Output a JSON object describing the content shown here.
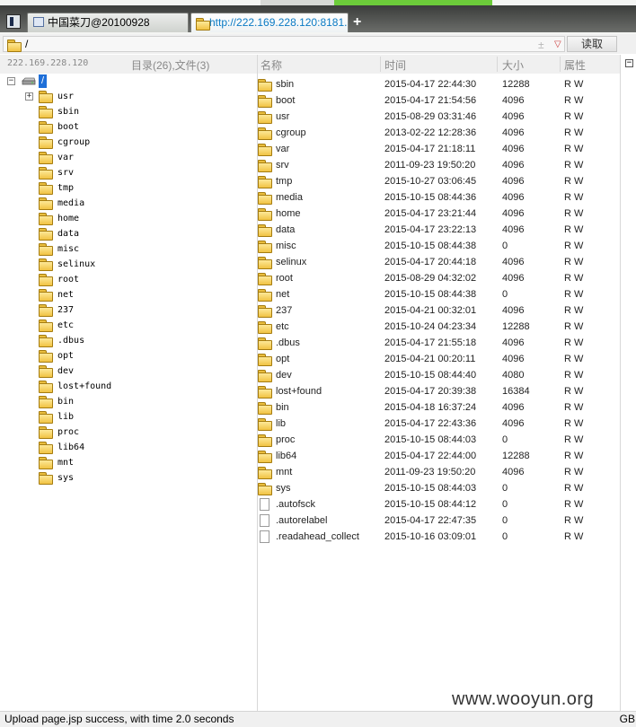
{
  "tabs": [
    {
      "label": "中国菜刀@20100928",
      "active": false
    },
    {
      "label": "http://222.169.228.120:8181...",
      "active": true
    }
  ],
  "new_tab_label": "+",
  "address": {
    "path": "/",
    "star": "±",
    "dropdown": "▽",
    "read_button": "读取"
  },
  "left_header": {
    "server": "222.169.228.120",
    "counts": "目录(26),文件(3)"
  },
  "tree": {
    "root_label": "/",
    "root_expander": "−",
    "usr_expander": "+",
    "items": [
      "usr",
      "sbin",
      "boot",
      "cgroup",
      "var",
      "srv",
      "tmp",
      "media",
      "home",
      "data",
      "misc",
      "selinux",
      "root",
      "net",
      "237",
      "etc",
      ".dbus",
      "opt",
      "dev",
      "lost+found",
      "bin",
      "lib",
      "proc",
      "lib64",
      "mnt",
      "sys"
    ]
  },
  "columns": {
    "name": "名称",
    "time": "时间",
    "size": "大小",
    "attr": "属性"
  },
  "files": [
    {
      "name": "sbin",
      "time": "2015-04-17 22:44:30",
      "size": "12288",
      "attr": "R W",
      "type": "dir"
    },
    {
      "name": "boot",
      "time": "2015-04-17 21:54:56",
      "size": "4096",
      "attr": "R W",
      "type": "dir"
    },
    {
      "name": "usr",
      "time": "2015-08-29 03:31:46",
      "size": "4096",
      "attr": "R W",
      "type": "dir"
    },
    {
      "name": "cgroup",
      "time": "2013-02-22 12:28:36",
      "size": "4096",
      "attr": "R W",
      "type": "dir"
    },
    {
      "name": "var",
      "time": "2015-04-17 21:18:11",
      "size": "4096",
      "attr": "R W",
      "type": "dir"
    },
    {
      "name": "srv",
      "time": "2011-09-23 19:50:20",
      "size": "4096",
      "attr": "R W",
      "type": "dir"
    },
    {
      "name": "tmp",
      "time": "2015-10-27 03:06:45",
      "size": "4096",
      "attr": "R W",
      "type": "dir"
    },
    {
      "name": "media",
      "time": "2015-10-15 08:44:36",
      "size": "4096",
      "attr": "R W",
      "type": "dir"
    },
    {
      "name": "home",
      "time": "2015-04-17 23:21:44",
      "size": "4096",
      "attr": "R W",
      "type": "dir"
    },
    {
      "name": "data",
      "time": "2015-04-17 23:22:13",
      "size": "4096",
      "attr": "R W",
      "type": "dir"
    },
    {
      "name": "misc",
      "time": "2015-10-15 08:44:38",
      "size": "0",
      "attr": "R W",
      "type": "dir"
    },
    {
      "name": "selinux",
      "time": "2015-04-17 20:44:18",
      "size": "4096",
      "attr": "R W",
      "type": "dir"
    },
    {
      "name": "root",
      "time": "2015-08-29 04:32:02",
      "size": "4096",
      "attr": "R W",
      "type": "dir"
    },
    {
      "name": "net",
      "time": "2015-10-15 08:44:38",
      "size": "0",
      "attr": "R W",
      "type": "dir"
    },
    {
      "name": "237",
      "time": "2015-04-21 00:32:01",
      "size": "4096",
      "attr": "R W",
      "type": "dir"
    },
    {
      "name": "etc",
      "time": "2015-10-24 04:23:34",
      "size": "12288",
      "attr": "R W",
      "type": "dir"
    },
    {
      "name": ".dbus",
      "time": "2015-04-17 21:55:18",
      "size": "4096",
      "attr": "R W",
      "type": "dir"
    },
    {
      "name": "opt",
      "time": "2015-04-21 00:20:11",
      "size": "4096",
      "attr": "R W",
      "type": "dir"
    },
    {
      "name": "dev",
      "time": "2015-10-15 08:44:40",
      "size": "4080",
      "attr": "R W",
      "type": "dir"
    },
    {
      "name": "lost+found",
      "time": "2015-04-17 20:39:38",
      "size": "16384",
      "attr": "R W",
      "type": "dir"
    },
    {
      "name": "bin",
      "time": "2015-04-18 16:37:24",
      "size": "4096",
      "attr": "R W",
      "type": "dir"
    },
    {
      "name": "lib",
      "time": "2015-04-17 22:43:36",
      "size": "4096",
      "attr": "R W",
      "type": "dir"
    },
    {
      "name": "proc",
      "time": "2015-10-15 08:44:03",
      "size": "0",
      "attr": "R W",
      "type": "dir"
    },
    {
      "name": "lib64",
      "time": "2015-04-17 22:44:00",
      "size": "12288",
      "attr": "R W",
      "type": "dir"
    },
    {
      "name": "mnt",
      "time": "2011-09-23 19:50:20",
      "size": "4096",
      "attr": "R W",
      "type": "dir"
    },
    {
      "name": "sys",
      "time": "2015-10-15 08:44:03",
      "size": "0",
      "attr": "R W",
      "type": "dir"
    },
    {
      "name": ".autofsck",
      "time": "2015-10-15 08:44:12",
      "size": "0",
      "attr": "R W",
      "type": "file"
    },
    {
      "name": ".autorelabel",
      "time": "2015-04-17 22:47:35",
      "size": "0",
      "attr": "R W",
      "type": "file"
    },
    {
      "name": ".readahead_collect",
      "time": "2015-10-16 03:09:01",
      "size": "0",
      "attr": "R W",
      "type": "file"
    }
  ],
  "panel_collapse": "−",
  "status": {
    "message": "Upload page.jsp success, with time 2.0 seconds",
    "encoding": "GB"
  },
  "watermark": "www.wooyun.org"
}
